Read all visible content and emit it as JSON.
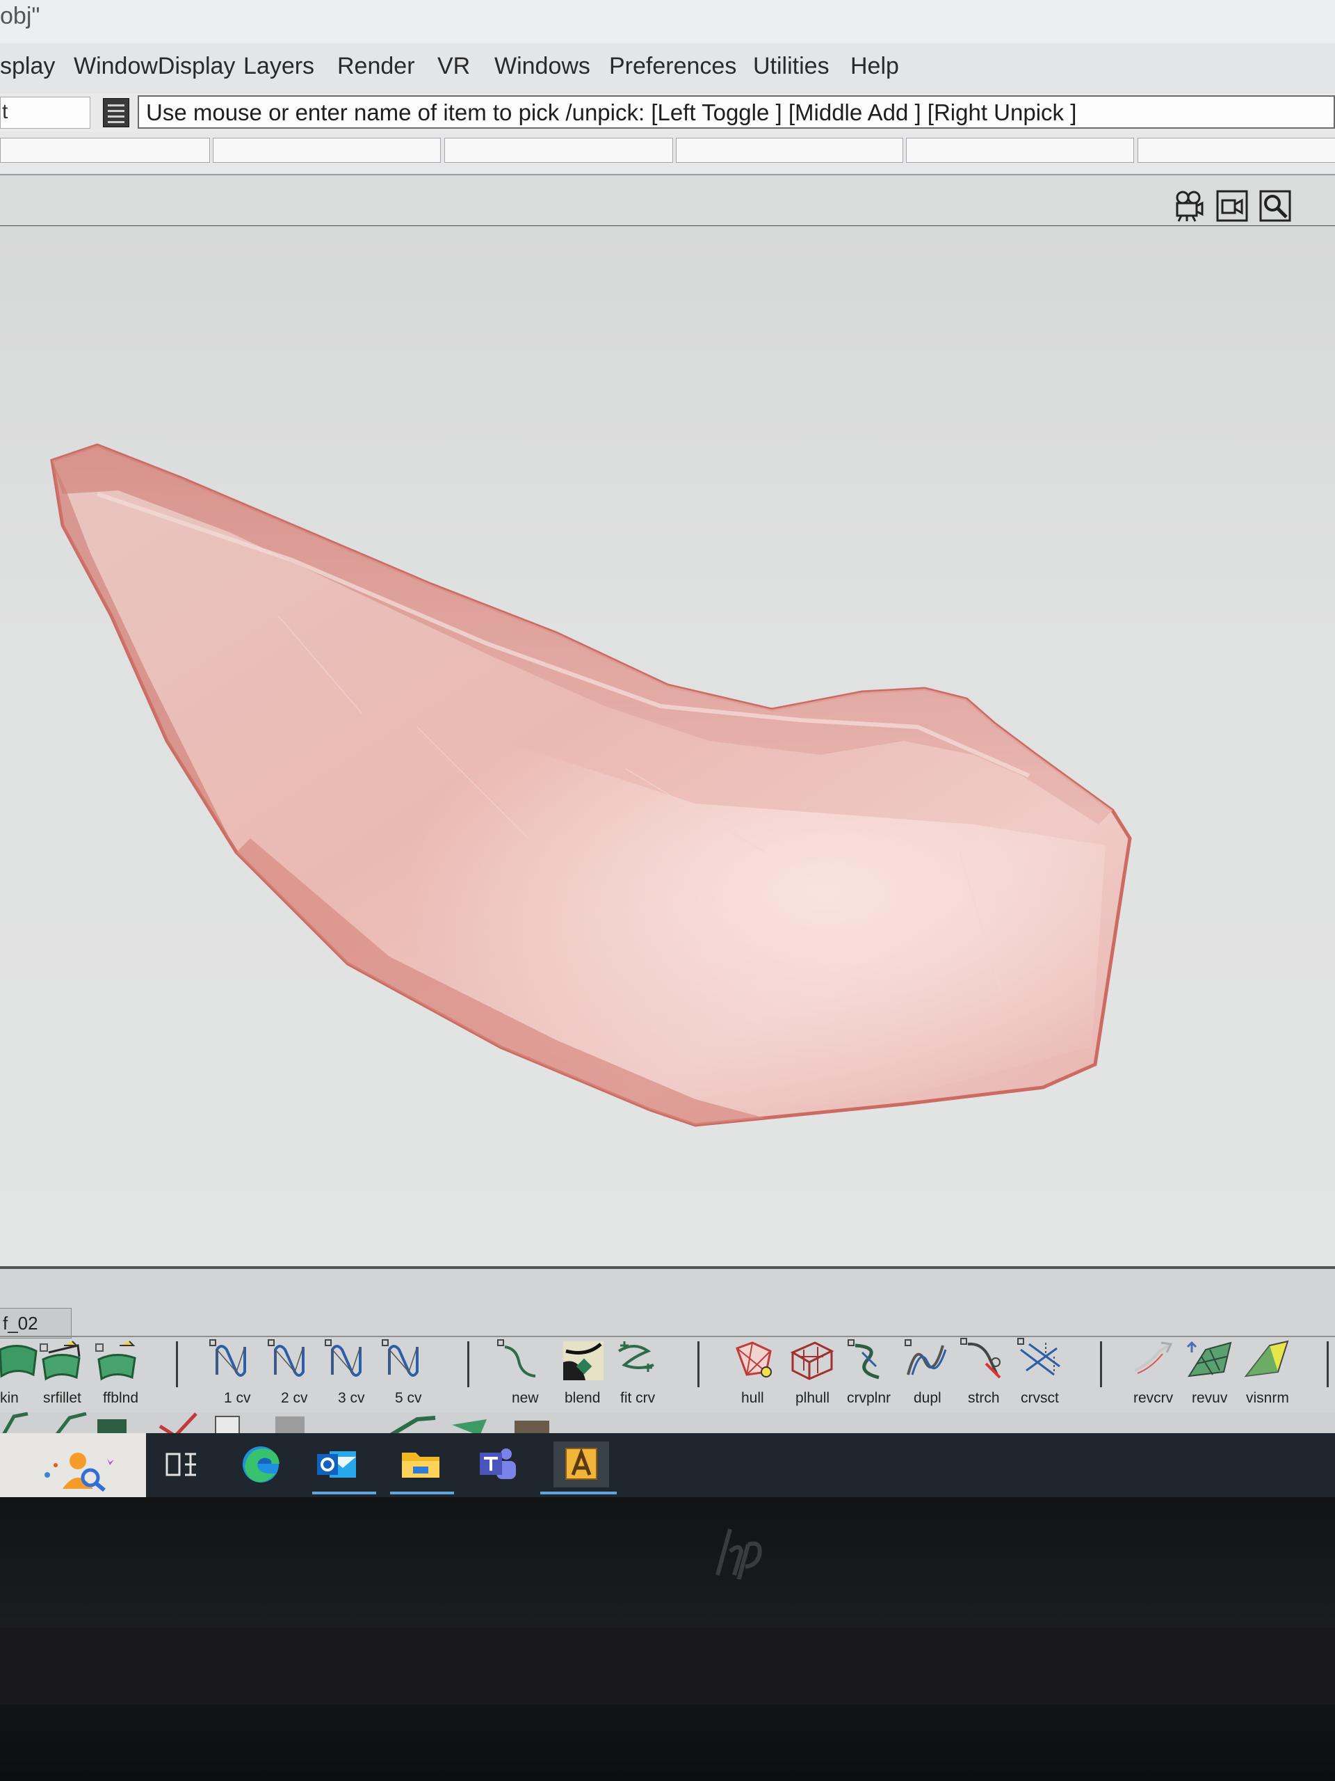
{
  "window": {
    "title": "obj\""
  },
  "menu": {
    "items": [
      "splay",
      "WindowDisplay",
      "Layers",
      "Render",
      "VR",
      "Windows",
      "Preferences",
      "Utilities",
      "Help"
    ]
  },
  "prompt": {
    "left_value": "t",
    "message": "Use mouse or enter name of item to pick /unpick: [Left Toggle ] [Middle Add ] [Right Unpick ]"
  },
  "viewport": {
    "icons": [
      "camera-icon",
      "camera-frame-icon",
      "magnifier-icon"
    ],
    "model_color": "#d9908a"
  },
  "shelf": {
    "tab_label": "f_02",
    "tools": [
      {
        "label": "kin",
        "icon": "skin-icon"
      },
      {
        "label": "srfillet",
        "icon": "surface-fillet-icon"
      },
      {
        "label": "ffblnd",
        "icon": "freeform-blend-icon"
      },
      {
        "label": "1 cv",
        "icon": "curve-1cv-icon"
      },
      {
        "label": "2 cv",
        "icon": "curve-2cv-icon"
      },
      {
        "label": "3 cv",
        "icon": "curve-3cv-icon"
      },
      {
        "label": "5 cv",
        "icon": "curve-5cv-icon"
      },
      {
        "label": "new",
        "icon": "new-curve-icon"
      },
      {
        "label": "blend",
        "icon": "blend-curve-icon"
      },
      {
        "label": "fit crv",
        "icon": "fit-curve-icon"
      },
      {
        "label": "hull",
        "icon": "hull-icon"
      },
      {
        "label": "plhull",
        "icon": "planar-hull-icon"
      },
      {
        "label": "crvplnr",
        "icon": "curve-planar-icon"
      },
      {
        "label": "dupl",
        "icon": "duplicate-curve-icon"
      },
      {
        "label": "strch",
        "icon": "stretch-icon"
      },
      {
        "label": "crvsct",
        "icon": "curve-section-icon"
      },
      {
        "label": "revcrv",
        "icon": "reverse-curve-icon"
      },
      {
        "label": "revuv",
        "icon": "reverse-uv-icon"
      },
      {
        "label": "visnrm",
        "icon": "visualize-normals-icon"
      }
    ]
  },
  "taskbar": {
    "items": [
      "search-people-icon",
      "task-view-icon",
      "edge-icon",
      "outlook-icon",
      "file-explorer-icon",
      "teams-icon",
      "alias-icon"
    ],
    "accent": "#5fa6df"
  },
  "bezel": {
    "logo": "hp"
  }
}
